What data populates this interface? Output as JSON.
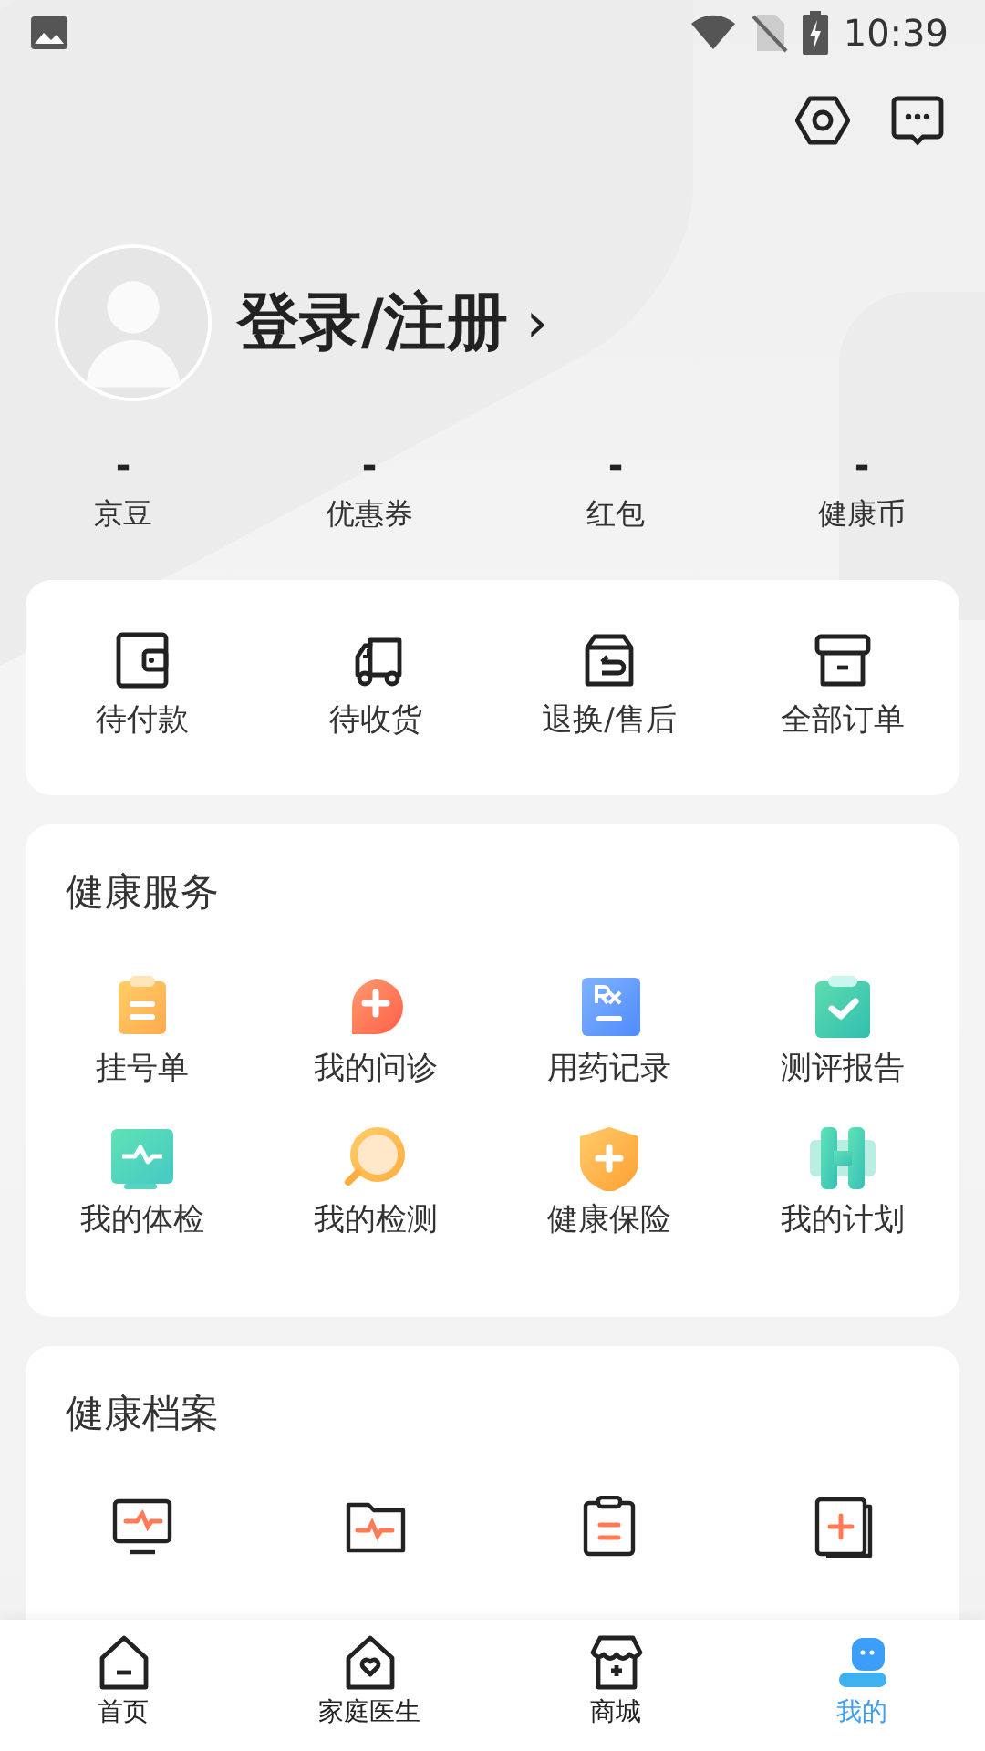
{
  "status_bar": {
    "time": "10:39"
  },
  "profile": {
    "login_label": "登录/注册",
    "chevron": "›"
  },
  "stats": [
    {
      "value": "-",
      "label": "京豆"
    },
    {
      "value": "-",
      "label": "优惠券"
    },
    {
      "value": "-",
      "label": "红包"
    },
    {
      "value": "-",
      "label": "健康币"
    }
  ],
  "orders": [
    {
      "label": "待付款"
    },
    {
      "label": "待收货"
    },
    {
      "label": "退换/售后"
    },
    {
      "label": "全部订单"
    }
  ],
  "health_services": {
    "title": "健康服务",
    "items": [
      {
        "label": "挂号单"
      },
      {
        "label": "我的问诊"
      },
      {
        "label": "用药记录"
      },
      {
        "label": "测评报告"
      },
      {
        "label": "我的体检"
      },
      {
        "label": "我的检测"
      },
      {
        "label": "健康保险"
      },
      {
        "label": "我的计划"
      }
    ]
  },
  "health_records": {
    "title": "健康档案"
  },
  "bottom_nav": [
    {
      "label": "首页",
      "selected": false
    },
    {
      "label": "家庭医生",
      "selected": false
    },
    {
      "label": "商城",
      "selected": false
    },
    {
      "label": "我的",
      "selected": true
    }
  ]
}
